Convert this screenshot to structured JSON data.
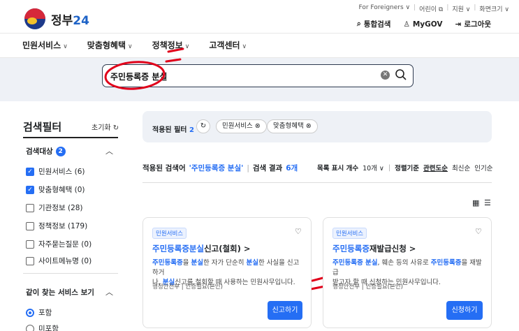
{
  "brand": {
    "name_prefix": "정부",
    "name_suffix": "24"
  },
  "top_links": [
    "For Foreigners ∨",
    "어린이 ⧉",
    "지원 ∨",
    "화면크기 ∨"
  ],
  "utility": {
    "search": "통합검색",
    "mygov": "MyGOV",
    "login": "로그아웃"
  },
  "nav": [
    "민원서비스",
    "맞춤형혜택",
    "정책정보",
    "고객센터"
  ],
  "search": {
    "value": "주민등록증 분실"
  },
  "sidebar": {
    "title": "검색필터",
    "reset": "초기화",
    "target_label": "검색대상",
    "target_count": "2",
    "checks": [
      {
        "label": "민원서비스 (6)",
        "checked": true
      },
      {
        "label": "맞춤형혜택 (0)",
        "checked": true
      },
      {
        "label": "기관정보 (28)",
        "checked": false
      },
      {
        "label": "정책정보 (179)",
        "checked": false
      },
      {
        "label": "자주묻는질문 (0)",
        "checked": false
      },
      {
        "label": "사이트메뉴명 (0)",
        "checked": false
      }
    ],
    "svc_title": "같이 찾는 서비스 보기",
    "radios": [
      {
        "label": "포함",
        "selected": true
      },
      {
        "label": "미포함",
        "selected": false
      }
    ]
  },
  "filters": {
    "label": "적용된 필터",
    "count": "2",
    "chips": [
      "민원서비스 ⊗",
      "맞춤형혜택 ⊗"
    ]
  },
  "results": {
    "prefix": "적용된 검색어",
    "query": "'주민등록증 분실'",
    "sep": "|",
    "count_label": "검색 결과",
    "count": "6개"
  },
  "sort": {
    "list_label": "목록 표시 개수",
    "list_value": "10개 ∨",
    "sep": "|",
    "sort_label": "정렬기준",
    "options": [
      "관련도순",
      "최신순",
      "인기순"
    ]
  },
  "cards": [
    {
      "tag": "민원서비스",
      "title_hl": "주민등록증분실",
      "title_rest": "신고(철회) >",
      "d1_hl": "주민등록증",
      "d1a": "을 ",
      "d1_hl2": "분실",
      "d1b": "한 자가 단순히 ",
      "d1_hl3": "분실",
      "d1c": "한 사실을 신고하거",
      "d2a": "나, ",
      "d2_hl": "분실",
      "d2b": "신고를 철회할 때 사용하는 민원사무입니다.",
      "meta": "행정안전부 | 인증필요(본인)",
      "button": "신고하기"
    },
    {
      "tag": "민원서비스",
      "title_hl": "주민등록증",
      "title_rest": "재발급신청 >",
      "d1_hl": "주민등록증 분실",
      "d1a": ", 훼손 등의 사유로 ",
      "d1_hl2": "주민등록증",
      "d1b": "을 재발급",
      "d2a": "받고자 할 때 신청하는 민원사무입니다.",
      "meta": "행정안전부 | 인증필요(본인)",
      "button": "신청하기"
    }
  ],
  "colors": {
    "accent": "#256ef4",
    "annotation": "#e0001a"
  }
}
